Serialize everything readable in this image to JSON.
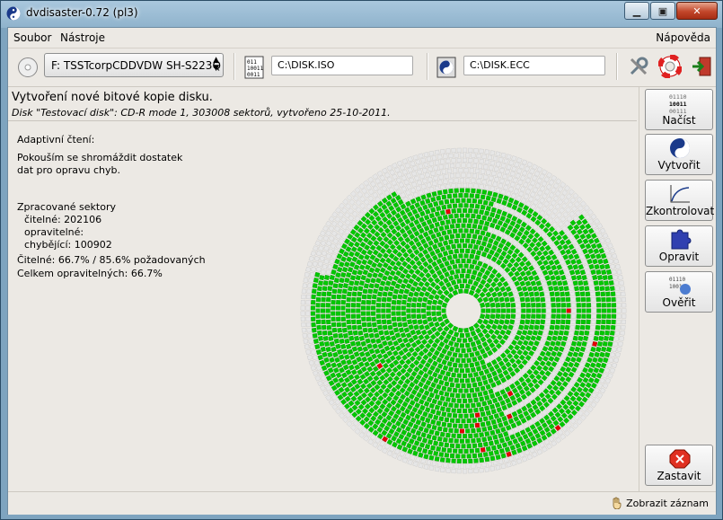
{
  "window": {
    "title": "dvdisaster-0.72 (pl3)"
  },
  "menu": {
    "file": "Soubor",
    "tools": "Nástroje",
    "help": "Nápověda"
  },
  "toolbar": {
    "drive": "F: TSSTcorpCDDVDW SH-S223Q",
    "image_file": "C:\\DISK.ISO",
    "ecc_file": "C:\\DISK.ECC"
  },
  "main": {
    "heading": "Vytvoření nové bitové kopie disku.",
    "subheading": "Disk \"Testovací disk\": CD-R mode 1, 303008 sektorů, vytvořeno 25-10-2011.",
    "adaptive_title": "Adaptivní čtení:",
    "adaptive_msg_1": "Pokouším se shromáždit dostatek",
    "adaptive_msg_2": "dat pro opravu chyb.",
    "processed_title": "Zpracované sektory",
    "readable": "čitelné: 202106",
    "correctable": "opravitelné:",
    "missing": "chybějící: 100902",
    "readable_pct": "Čitelné: 66.7% / 85.6% požadovaných",
    "total_correctable": "Celkem opravitelných: 66.7%"
  },
  "actions": {
    "read": "Načíst",
    "create": "Vytvořit",
    "verify": "Zkontrolovat",
    "fix": "Opravit",
    "check": "Ověřit",
    "stop": "Zastavit"
  },
  "icon_text": {
    "binary_1": "01110",
    "binary_2": "10011",
    "binary_3": "00111"
  },
  "status": {
    "show_log": "Zobrazit záznam"
  },
  "colors": {
    "read_ok": "#00c800",
    "unread": "#e6e6e6",
    "error": "#e60000",
    "window_frame": "#8fb3cc"
  }
}
